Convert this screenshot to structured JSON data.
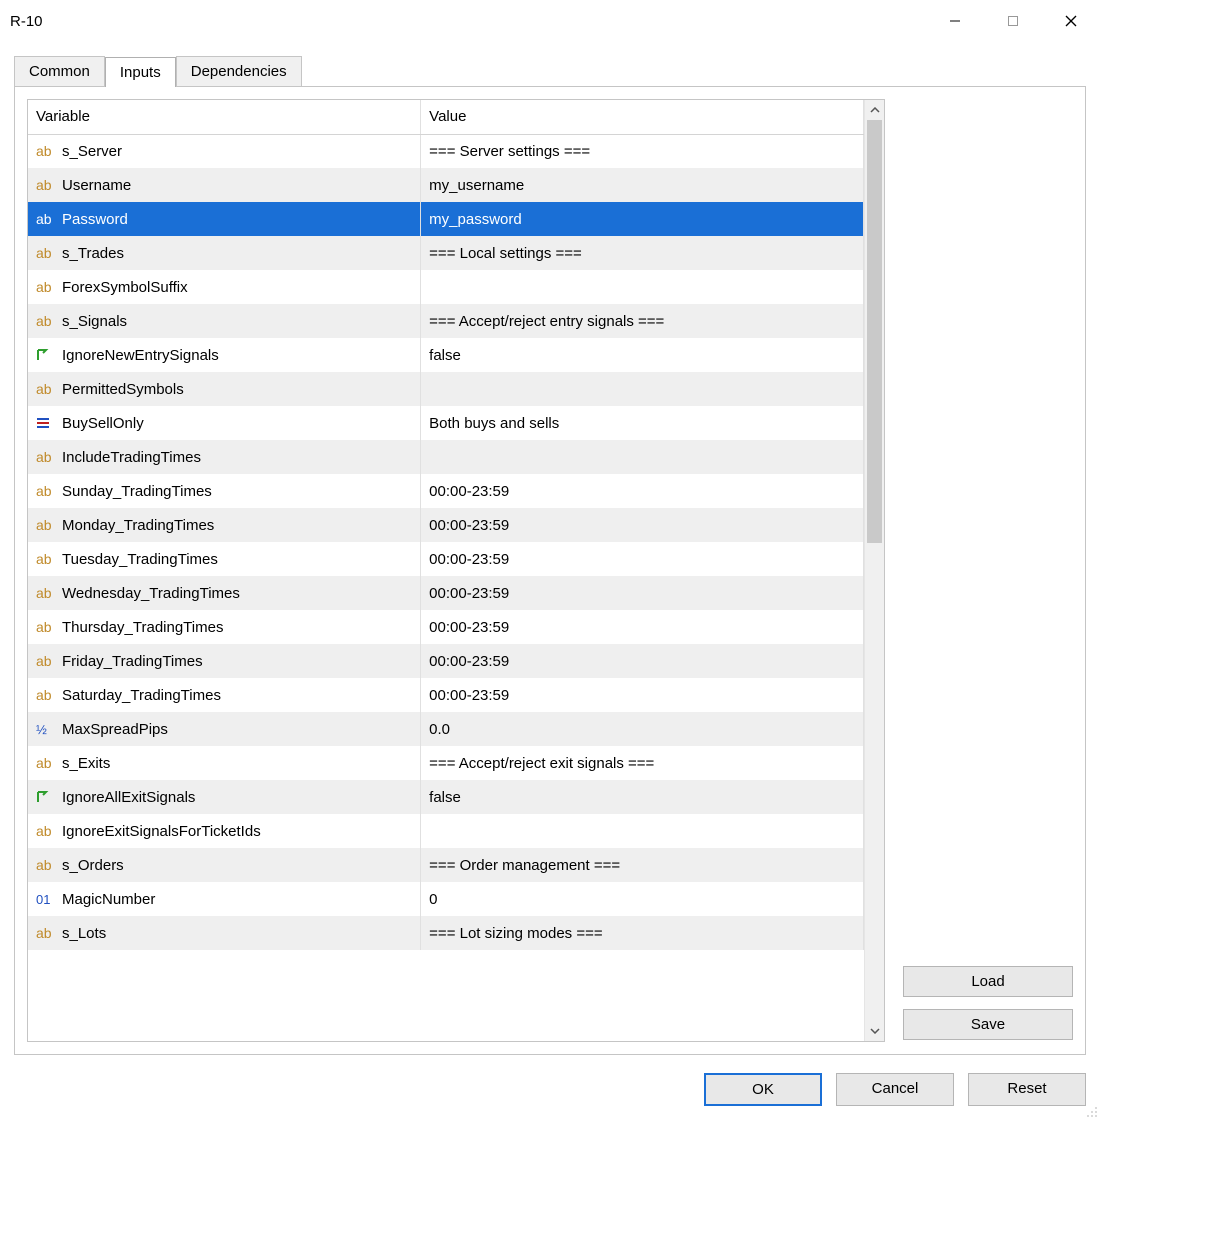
{
  "window": {
    "title": "R-10"
  },
  "tabs": [
    "Common",
    "Inputs",
    "Dependencies"
  ],
  "active_tab": 1,
  "table": {
    "headers": [
      "Variable",
      "Value"
    ],
    "rows": [
      {
        "icon": "ab",
        "variable": "s_Server",
        "value": "=== Server settings ==="
      },
      {
        "icon": "ab",
        "variable": "Username",
        "value": "my_username"
      },
      {
        "icon": "ab",
        "variable": "Password",
        "value": "my_password",
        "selected": true
      },
      {
        "icon": "ab",
        "variable": "s_Trades",
        "value": "=== Local settings ==="
      },
      {
        "icon": "ab",
        "variable": "ForexSymbolSuffix",
        "value": ""
      },
      {
        "icon": "ab",
        "variable": "s_Signals",
        "value": "=== Accept/reject entry signals ==="
      },
      {
        "icon": "bool",
        "variable": "IgnoreNewEntrySignals",
        "value": "false"
      },
      {
        "icon": "ab",
        "variable": "PermittedSymbols",
        "value": ""
      },
      {
        "icon": "enum",
        "variable": "BuySellOnly",
        "value": "Both buys and sells"
      },
      {
        "icon": "ab",
        "variable": "IncludeTradingTimes",
        "value": ""
      },
      {
        "icon": "ab",
        "variable": "Sunday_TradingTimes",
        "value": "00:00-23:59"
      },
      {
        "icon": "ab",
        "variable": "Monday_TradingTimes",
        "value": "00:00-23:59"
      },
      {
        "icon": "ab",
        "variable": "Tuesday_TradingTimes",
        "value": "00:00-23:59"
      },
      {
        "icon": "ab",
        "variable": "Wednesday_TradingTimes",
        "value": "00:00-23:59"
      },
      {
        "icon": "ab",
        "variable": "Thursday_TradingTimes",
        "value": "00:00-23:59"
      },
      {
        "icon": "ab",
        "variable": "Friday_TradingTimes",
        "value": "00:00-23:59"
      },
      {
        "icon": "ab",
        "variable": "Saturday_TradingTimes",
        "value": "00:00-23:59"
      },
      {
        "icon": "num",
        "variable": "MaxSpreadPips",
        "value": "0.0"
      },
      {
        "icon": "ab",
        "variable": "s_Exits",
        "value": "=== Accept/reject exit signals ==="
      },
      {
        "icon": "bool",
        "variable": "IgnoreAllExitSignals",
        "value": "false"
      },
      {
        "icon": "ab",
        "variable": "IgnoreExitSignalsForTicketIds",
        "value": ""
      },
      {
        "icon": "ab",
        "variable": "s_Orders",
        "value": "=== Order management ==="
      },
      {
        "icon": "int",
        "variable": "MagicNumber",
        "value": "0"
      },
      {
        "icon": "ab",
        "variable": "s_Lots",
        "value": "=== Lot sizing modes ==="
      }
    ]
  },
  "side_buttons": {
    "load": "Load",
    "save": "Save"
  },
  "footer_buttons": {
    "ok": "OK",
    "cancel": "Cancel",
    "reset": "Reset"
  }
}
